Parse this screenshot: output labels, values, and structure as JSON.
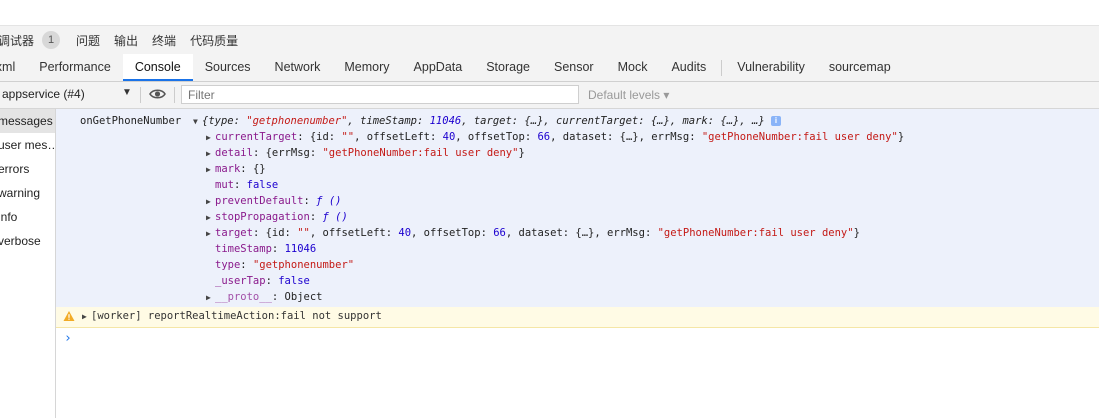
{
  "panel_tabs": [
    "调试器",
    "1",
    "问题",
    "输出",
    "终端",
    "代码质量"
  ],
  "tool_tabs": [
    "Wxml",
    "Performance",
    "Console",
    "Sources",
    "Network",
    "Memory",
    "AppData",
    "Storage",
    "Sensor",
    "Mock",
    "Audits",
    "Vulnerability",
    "sourcemap"
  ],
  "active_tab": "Console",
  "filterbar": {
    "context": "appservice (#4)",
    "filter_placeholder": "Filter",
    "levels": "Default levels ▾"
  },
  "sidebar": [
    "messages",
    "user mes…",
    "errors",
    "warning",
    "info",
    "verbose"
  ],
  "log": {
    "source": "onGetPhoneNumber",
    "summary": {
      "open": "{type: ",
      "type_val": "\"getphonenumber\"",
      "ts_key": ", timeStamp: ",
      "ts_val": "11046",
      "rest": ", target: {…}, currentTarget: {…}, mark: {…}, …}"
    },
    "current_target": {
      "key": "currentTarget",
      "a": ": {id: ",
      "id": "\"\"",
      "b": ", offsetLeft: ",
      "ol": "40",
      "c": ", offsetTop: ",
      "ot": "66",
      "d": ", dataset: {…}, errMsg: ",
      "err": "\"getPhoneNumber:fail user deny\"",
      "e": "}"
    },
    "detail": {
      "key": "detail",
      "a": ": {errMsg: ",
      "err": "\"getPhoneNumber:fail user deny\"",
      "b": "}"
    },
    "mark": {
      "key": "mark",
      "val": ": {}"
    },
    "mut": {
      "key": "mut",
      "sep": ": ",
      "val": "false"
    },
    "prevent": {
      "key": "preventDefault",
      "sep": ": ",
      "val": "ƒ ()"
    },
    "stop": {
      "key": "stopPropagation",
      "sep": ": ",
      "val": "ƒ ()"
    },
    "target": {
      "key": "target",
      "a": ": {id: ",
      "id": "\"\"",
      "b": ", offsetLeft: ",
      "ol": "40",
      "c": ", offsetTop: ",
      "ot": "66",
      "d": ", dataset: {…}, errMsg: ",
      "err": "\"getPhoneNumber:fail user deny\"",
      "e": "}"
    },
    "timestamp": {
      "key": "timeStamp",
      "sep": ": ",
      "val": "11046"
    },
    "type": {
      "key": "type",
      "sep": ": ",
      "val": "\"getphonenumber\""
    },
    "usertap": {
      "key": "_userTap",
      "sep": ": ",
      "val": "false"
    },
    "proto": {
      "key": "__proto__",
      "val": ": Object"
    }
  },
  "warning": "[worker] reportRealtimeAction:fail not support",
  "prompt": "›"
}
